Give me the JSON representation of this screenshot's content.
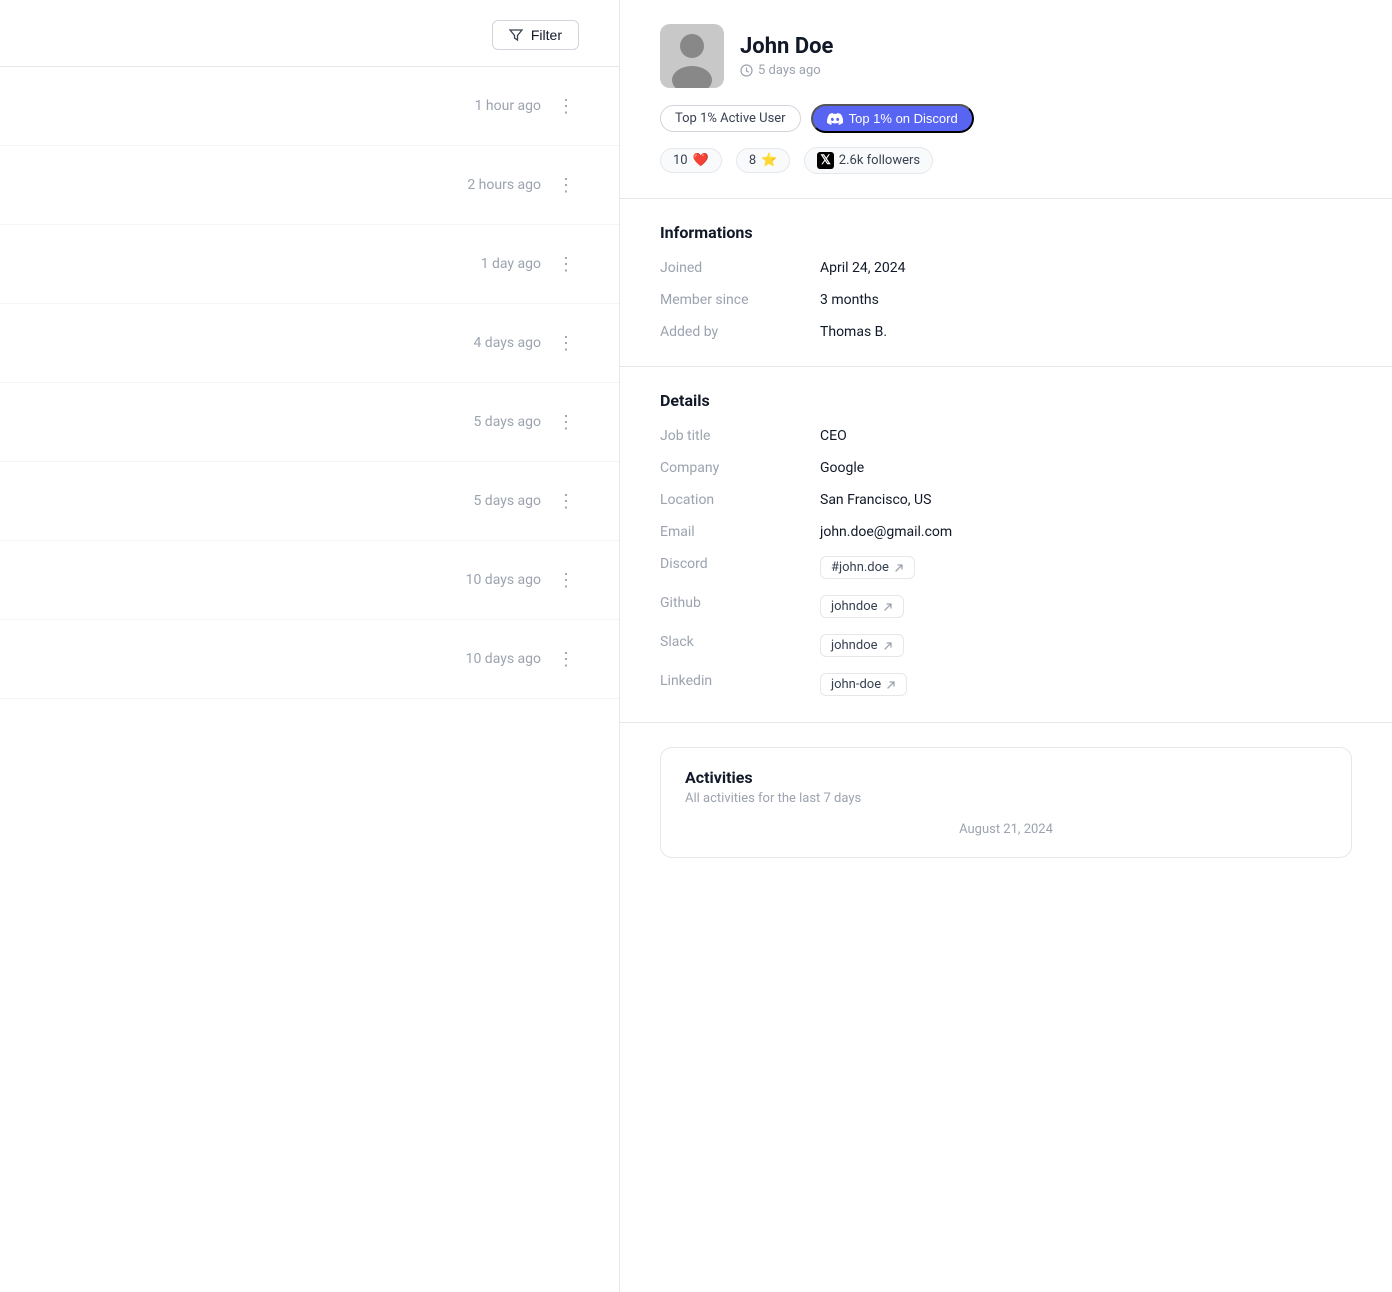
{
  "left": {
    "filter_label": "Filter",
    "items": [
      {
        "time": "1 hour ago"
      },
      {
        "time": "2 hours ago"
      },
      {
        "time": "1 day ago"
      },
      {
        "time": "4 days ago"
      },
      {
        "time": "5 days ago"
      },
      {
        "time": "5 days ago"
      },
      {
        "time": "10 days ago"
      },
      {
        "time": "10 days ago"
      }
    ]
  },
  "profile": {
    "name": "John Doe",
    "last_seen": "5 days ago",
    "badge_active": "Top 1% Active User",
    "badge_discord": "Top 1% on Discord",
    "hearts_count": "10",
    "stars_count": "8",
    "followers": "2.6k followers",
    "hearts_icon": "❤️",
    "stars_icon": "⭐"
  },
  "informations": {
    "title": "Informations",
    "fields": [
      {
        "label": "Joined",
        "value": "April 24, 2024"
      },
      {
        "label": "Member since",
        "value": "3 months"
      },
      {
        "label": "Added by",
        "value": "Thomas B."
      }
    ]
  },
  "details": {
    "title": "Details",
    "fields": [
      {
        "label": "Job title",
        "value": "CEO",
        "type": "text"
      },
      {
        "label": "Company",
        "value": "Google",
        "type": "text"
      },
      {
        "label": "Location",
        "value": "San Francisco, US",
        "type": "text"
      },
      {
        "label": "Email",
        "value": "john.doe@gmail.com",
        "type": "text"
      },
      {
        "label": "Discord",
        "value": "#john.doe",
        "type": "link"
      },
      {
        "label": "Github",
        "value": "johndoe",
        "type": "link"
      },
      {
        "label": "Slack",
        "value": "johndoe",
        "type": "link"
      },
      {
        "label": "Linkedin",
        "value": "john-doe",
        "type": "link"
      }
    ]
  },
  "activities": {
    "title": "Activities",
    "subtitle": "All activities for the last 7 days",
    "date_label": "August 21, 2024"
  },
  "icons": {
    "filter": "⊳",
    "clock": "🕐",
    "external": "↗",
    "dots": "⋮",
    "discord_emoji": "🎮",
    "x_logo": "✕"
  }
}
